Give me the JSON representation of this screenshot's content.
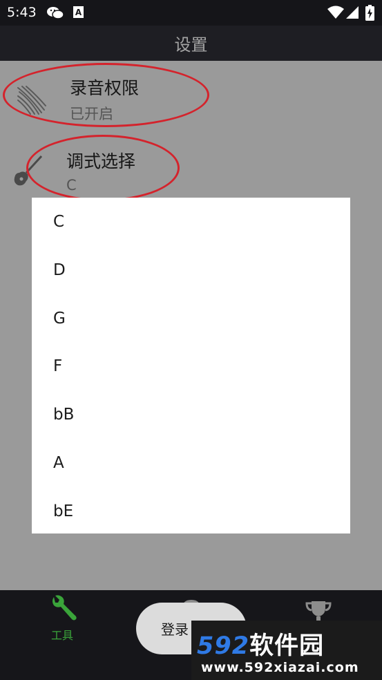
{
  "status_bar": {
    "time": "5:43",
    "icons": [
      "wechat-icon",
      "a-notification-icon",
      "wifi-icon",
      "signal-icon",
      "battery-charging-icon"
    ]
  },
  "header": {
    "title": "设置"
  },
  "settings": [
    {
      "title": "录音权限",
      "subtitle": "已开启",
      "icon": "mic-waves-icon"
    },
    {
      "title": "调式选择",
      "subtitle": "C",
      "icon": "guitar-icon"
    }
  ],
  "dialog": {
    "options": [
      "C",
      "D",
      "G",
      "F",
      "bB",
      "A",
      "bE"
    ]
  },
  "bottom_nav": {
    "tabs": [
      {
        "label": "工具",
        "icon": "wrench-icon",
        "active": true
      },
      {
        "label": "",
        "icon": "location-pin-icon",
        "active": false
      },
      {
        "label": "",
        "icon": "trophy-icon",
        "active": false
      }
    ],
    "login_label": "登录"
  },
  "watermark": {
    "brand_num": "592",
    "brand_cn": "软件园",
    "url": "www.592xiazai.com"
  },
  "colors": {
    "accent_green": "#3aa43a",
    "annotation_red": "#d4232c",
    "watermark_blue": "#2f7ae5"
  }
}
